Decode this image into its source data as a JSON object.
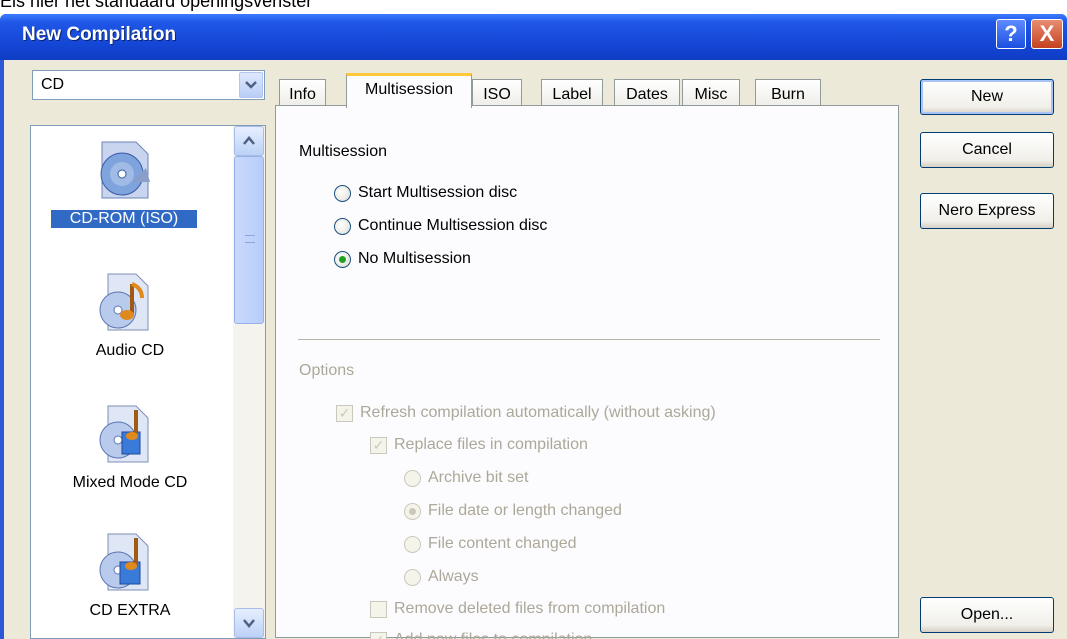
{
  "caption": "Els hier het standaard openingsvenster",
  "window": {
    "title": "New Compilation",
    "help_label": "?",
    "close_label": "X"
  },
  "media_combo": {
    "value": "CD"
  },
  "compilation_types": [
    {
      "label": "CD-ROM (ISO)",
      "icon": "cd-rom-iso-icon",
      "selected": true
    },
    {
      "label": "Audio CD",
      "icon": "audio-cd-icon",
      "selected": false
    },
    {
      "label": "Mixed Mode CD",
      "icon": "mixed-mode-cd-icon",
      "selected": false
    },
    {
      "label": "CD EXTRA",
      "icon": "cd-extra-icon",
      "selected": false
    }
  ],
  "tabs": [
    {
      "label": "Info",
      "active": false
    },
    {
      "label": "Multisession",
      "active": true
    },
    {
      "label": "ISO",
      "active": false
    },
    {
      "label": "Label",
      "active": false
    },
    {
      "label": "Dates",
      "active": false
    },
    {
      "label": "Misc",
      "active": false
    },
    {
      "label": "Burn",
      "active": false
    }
  ],
  "multisession": {
    "title": "Multisession",
    "options": [
      {
        "label": "Start Multisession disc",
        "selected": false
      },
      {
        "label": "Continue Multisession disc",
        "selected": false
      },
      {
        "label": "No Multisession",
        "selected": true
      }
    ]
  },
  "options": {
    "title": "Options",
    "enabled": false,
    "refresh_label": "Refresh compilation automatically (without asking)",
    "refresh_checked": true,
    "replace_label": "Replace files in compilation",
    "replace_checked": true,
    "replace_modes": [
      {
        "label": "Archive bit set",
        "selected": false
      },
      {
        "label": "File date or length changed",
        "selected": true
      },
      {
        "label": "File content changed",
        "selected": false
      },
      {
        "label": "Always",
        "selected": false
      }
    ],
    "remove_label": "Remove deleted files from compilation",
    "remove_checked": false,
    "add_label": "Add new files to compilation",
    "add_checked": true
  },
  "buttons": {
    "new": "New",
    "cancel": "Cancel",
    "nero_express": "Nero Express",
    "open": "Open..."
  },
  "colors": {
    "titlebar": "#1648d8",
    "dialog_bg": "#ece9d8",
    "selection": "#316ac5",
    "active_tab_accent": "#ffc83c",
    "radio_dot": "#21a121"
  }
}
